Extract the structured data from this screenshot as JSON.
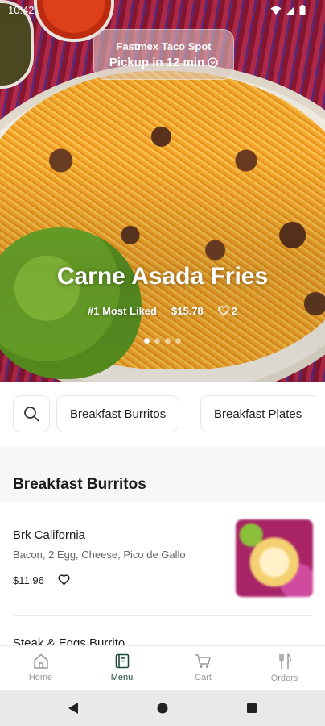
{
  "status": {
    "time": "10:42"
  },
  "hero": {
    "store_name": "Fastmex Taco Spot",
    "pickup": "Pickup in 12 min",
    "dish_title": "Carne Asada Fries",
    "badge": "#1 Most Liked",
    "price": "$15.78",
    "likes": "2",
    "carousel": {
      "count": 4,
      "active_index": 0
    }
  },
  "categories": {
    "items": [
      "Breakfast Burritos",
      "Breakfast Plates"
    ]
  },
  "section": {
    "title": "Breakfast Burritos",
    "items": [
      {
        "name": "Brk California",
        "description": "Bacon, 2 Egg, Cheese, Pico de Gallo",
        "price": "$11.96"
      },
      {
        "name": "Steak & Eggs Burrito"
      }
    ]
  },
  "bottom_nav": {
    "items": [
      {
        "label": "Home",
        "icon": "home-icon"
      },
      {
        "label": "Menu",
        "icon": "menu-book-icon",
        "active": true
      },
      {
        "label": "Cart",
        "icon": "cart-icon"
      },
      {
        "label": "Orders",
        "icon": "utensils-icon"
      }
    ]
  },
  "colors": {
    "accent": "#1f4a3a",
    "inactive": "#9a9a9a"
  }
}
